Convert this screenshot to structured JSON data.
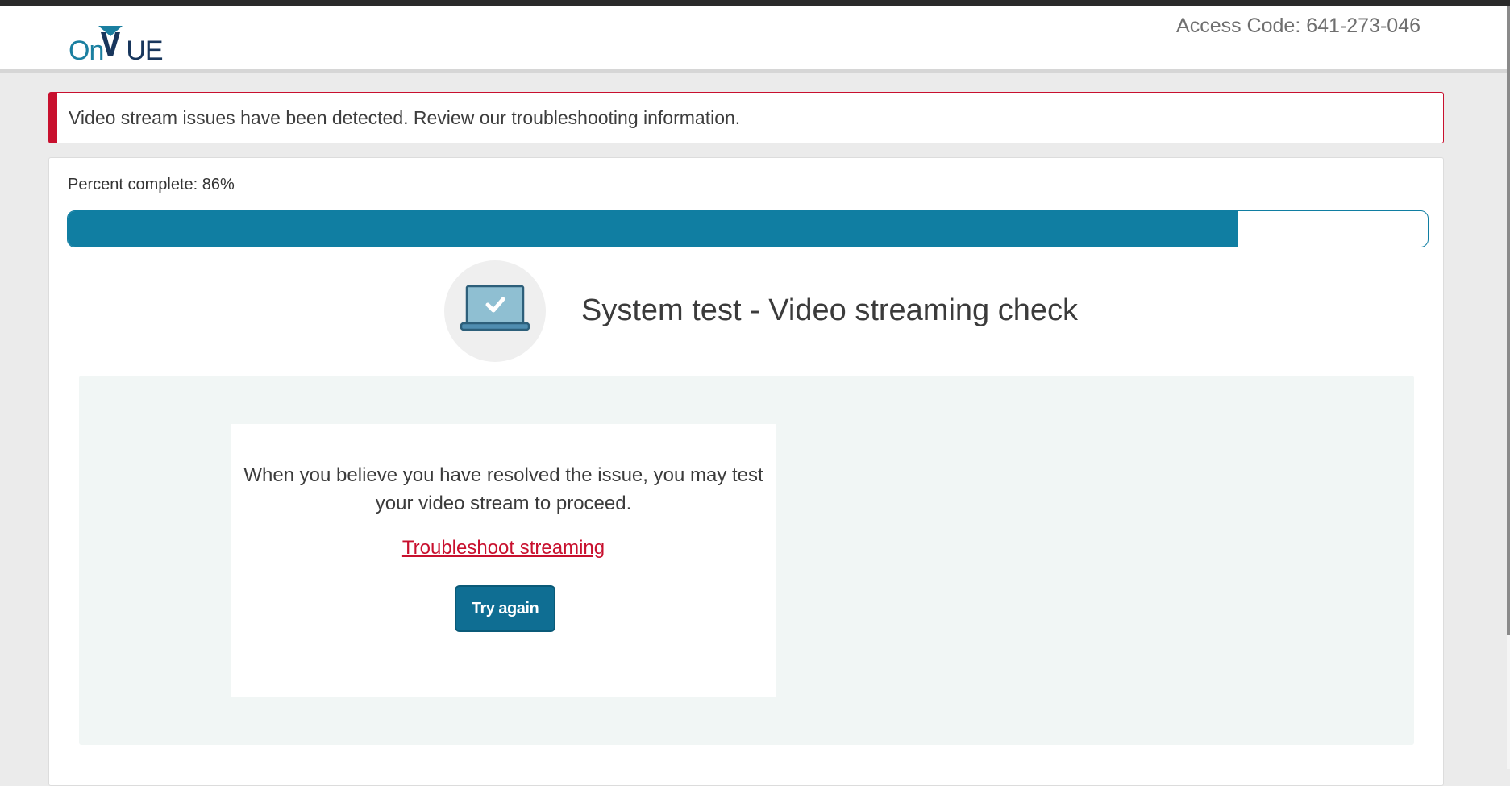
{
  "header": {
    "logo": {
      "text_on": "On",
      "text_v": "V",
      "text_ue": "UE",
      "icon": "onvue-logo"
    },
    "access_code": "Access Code: 641-273-046"
  },
  "alert": {
    "message": "Video stream issues have been detected. Review our troubleshooting information.",
    "color": "#c8102e"
  },
  "progress": {
    "label": "Percent complete: 86%",
    "value": 86,
    "color": "#107ea2"
  },
  "section": {
    "icon": "laptop-check-icon",
    "title": "System test - Video streaming check"
  },
  "panel": {
    "instructions": "When you believe you have resolved the issue, you may test your video stream to proceed.",
    "troubleshoot_link": "Troubleshoot streaming",
    "try_again_label": "Try again"
  },
  "colors": {
    "accent": "#107ea2",
    "error": "#c8102e",
    "panel_bg": "#f1f6f5"
  }
}
